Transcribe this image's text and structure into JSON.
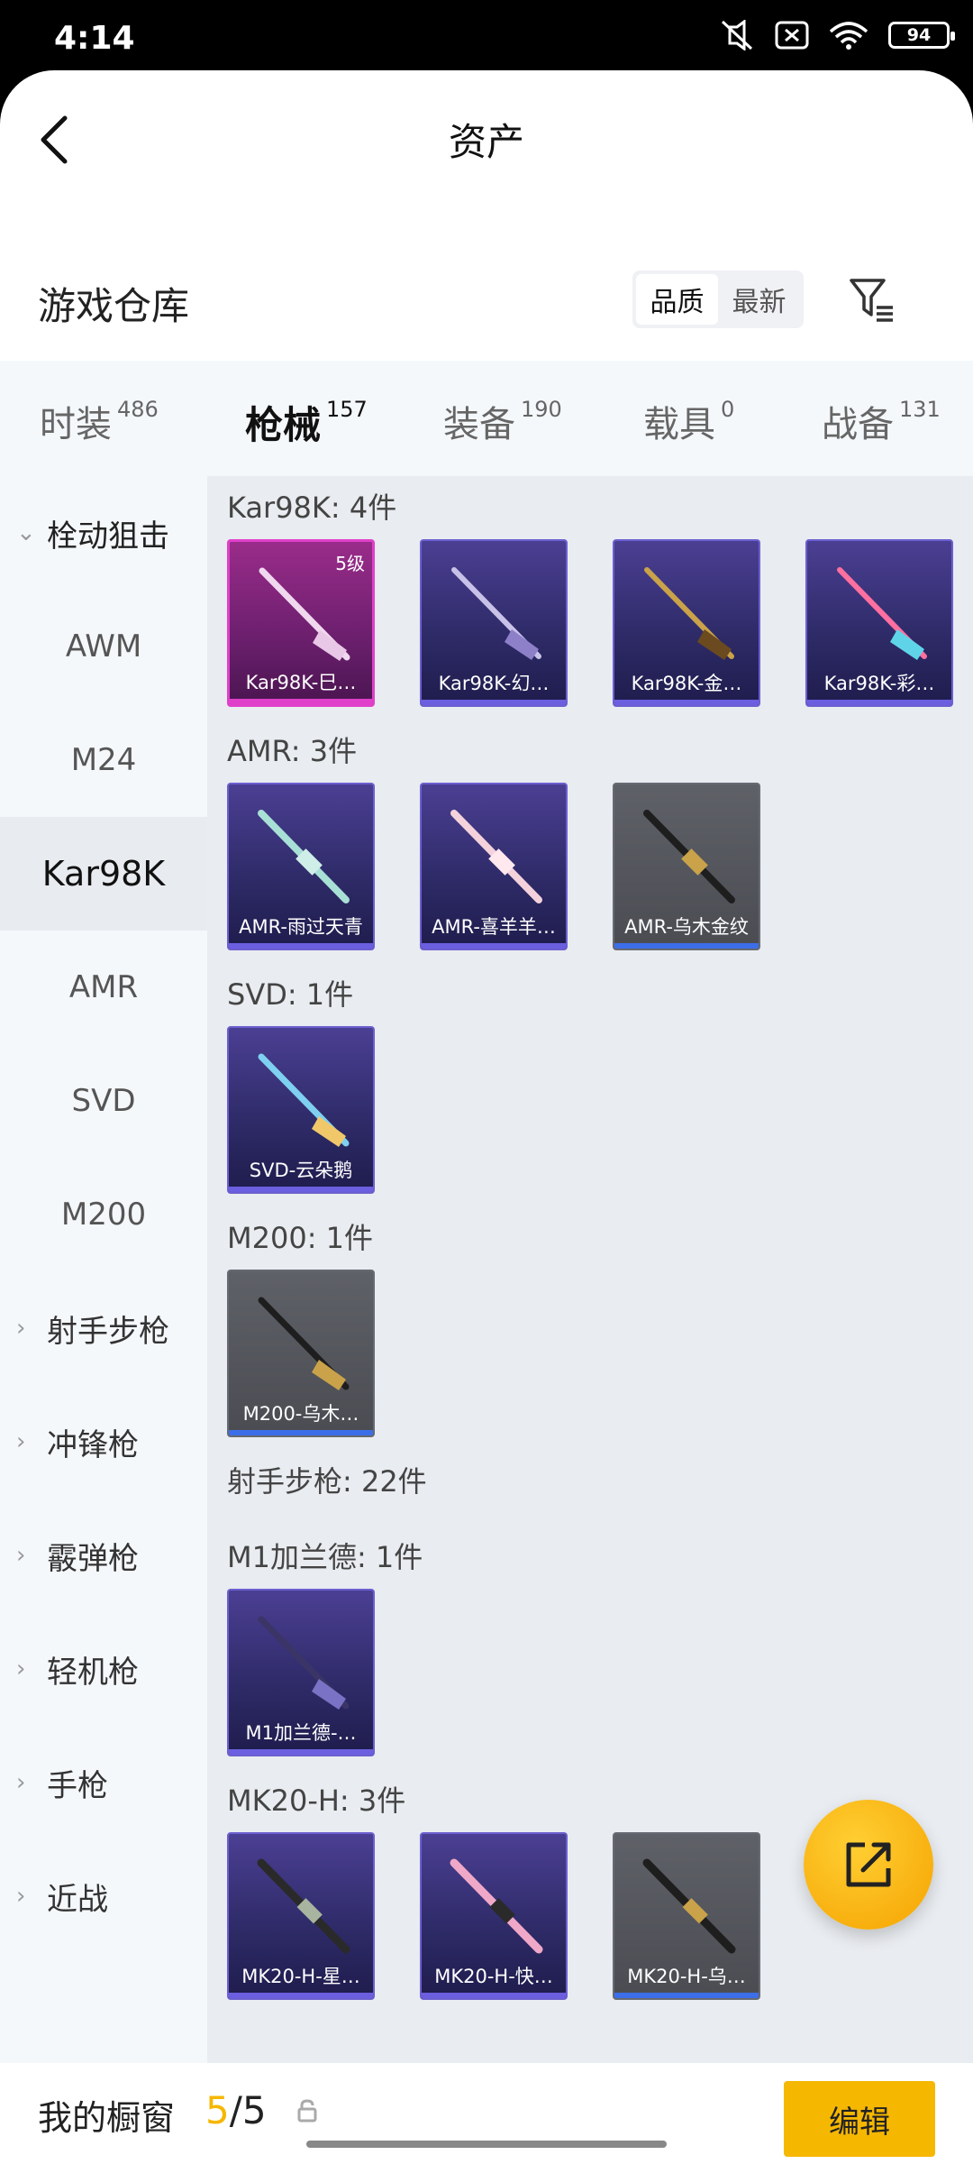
{
  "status": {
    "time": "4:14",
    "battery": "94"
  },
  "header": {
    "title": "资产"
  },
  "warehouse": {
    "title": "游戏仓库",
    "sort_quality": "品质",
    "sort_newest": "最新"
  },
  "tabs": [
    {
      "label": "时装",
      "count": "486"
    },
    {
      "label": "枪械",
      "count": "157"
    },
    {
      "label": "装备",
      "count": "190"
    },
    {
      "label": "载具",
      "count": "0"
    },
    {
      "label": "战备",
      "count": "131"
    }
  ],
  "sidebar": [
    {
      "label": "栓动狙击"
    },
    {
      "label": "AWM"
    },
    {
      "label": "M24"
    },
    {
      "label": "Kar98K"
    },
    {
      "label": "AMR"
    },
    {
      "label": "SVD"
    },
    {
      "label": "M200"
    },
    {
      "label": "射手步枪"
    },
    {
      "label": "冲锋枪"
    },
    {
      "label": "霰弹枪"
    },
    {
      "label": "轻机枪"
    },
    {
      "label": "手枪"
    },
    {
      "label": "近战"
    }
  ],
  "groups": {
    "kar98k": "Kar98K: 4件",
    "amr": "AMR: 3件",
    "svd": "SVD: 1件",
    "m200": "M200: 1件",
    "marksman": "射手步枪: 22件",
    "m1": "M1加兰德: 1件",
    "mk20": "MK20-H: 3件"
  },
  "cards": {
    "kar98k": [
      {
        "name": "Kar98K-巳…",
        "level": "5级"
      },
      {
        "name": "Kar98K-幻…"
      },
      {
        "name": "Kar98K-金…"
      },
      {
        "name": "Kar98K-彩…"
      }
    ],
    "amr": [
      {
        "name": "AMR-雨过天青"
      },
      {
        "name": "AMR-喜羊羊…"
      },
      {
        "name": "AMR-乌木金纹"
      }
    ],
    "svd": [
      {
        "name": "SVD-云朵鹅"
      }
    ],
    "m200": [
      {
        "name": "M200-乌木…"
      }
    ],
    "m1": [
      {
        "name": "M1加兰德-…"
      }
    ],
    "mk20": [
      {
        "name": "MK20-H-星…"
      },
      {
        "name": "MK20-H-快…"
      },
      {
        "name": "MK20-H-乌…"
      }
    ]
  },
  "showcase": {
    "label": "我的橱窗",
    "current": "5",
    "total": "/5",
    "edit_label": "编辑"
  },
  "colors": {
    "accent": "#f5b700",
    "purple_rarity": "#6b5fd0",
    "pink_rarity": "#e040c9",
    "gray_rarity": "#676a72"
  },
  "icons": [
    "back-arrow-icon",
    "mute-icon",
    "no-sim-icon",
    "wifi-icon",
    "battery-icon",
    "filter-icon",
    "caret-down-icon",
    "caret-right-icon",
    "share-icon",
    "lock-icon"
  ]
}
